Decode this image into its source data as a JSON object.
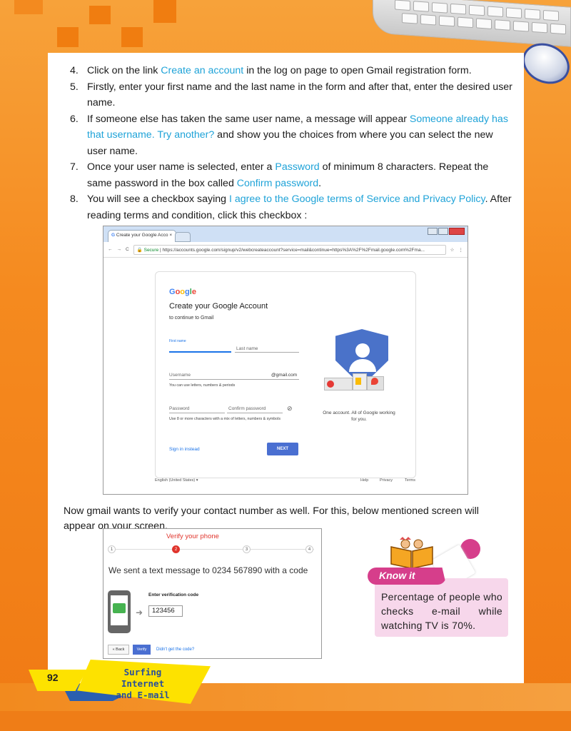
{
  "steps": [
    {
      "num": "4.",
      "parts": [
        "Click on the link ",
        "Create an account",
        " in the log on page to open Gmail registration form."
      ]
    },
    {
      "num": "5.",
      "text": "Firstly, enter your first name and the last name in the form and after that, enter the desired user name."
    },
    {
      "num": "6.",
      "parts": [
        "If someone else has taken the same user name, a message will appear ",
        "Someone already has that username. Try another?",
        " and show you the choices from where you can select the new user name."
      ]
    },
    {
      "num": "7.",
      "parts": [
        "Once your user name is selected, enter a ",
        "Password",
        " of minimum 8 characters. Repeat the same password in the box called ",
        "Confirm password",
        "."
      ]
    },
    {
      "num": "8.",
      "parts": [
        "You will see a checkbox saying ",
        "I agree to the Google terms of Service and Privacy Policy",
        ". After reading terms and condition, click this checkbox :"
      ]
    }
  ],
  "browser": {
    "tab_title": "Create your Google Acco",
    "tab_close": "×",
    "secure_label": "Secure",
    "url": "https://accounts.google.com/signup/v2/webcreateaccount?service=mail&continue=https%3A%2F%2Fmail.google.com%2Fma..."
  },
  "signup": {
    "logo": "Google",
    "title": "Create your Google Account",
    "subtitle": "to continue to Gmail",
    "first_name_label": "First name",
    "last_name_label": "Last name",
    "username_label": "Username",
    "gmail_suffix": "@gmail.com",
    "username_hint": "You can use letters, numbers & periods",
    "password_label": "Password",
    "confirm_label": "Confirm password",
    "password_hint": "Use 8 or more characters with a mix of letters, numbers & symbols",
    "signin_link": "Sign in instead",
    "next_button": "NEXT",
    "side_text": "One account. All of Google working for you.",
    "footer_lang": "English (United States) ▾",
    "footer_help": "Help",
    "footer_privacy": "Privacy",
    "footer_terms": "Terms"
  },
  "after_para": "Now gmail wants to verify your contact number as well. For this, below mentioned screen will appear on your screen.",
  "verify": {
    "title": "Verify your phone",
    "steps": [
      "1",
      "2",
      "3",
      "4"
    ],
    "sent": "We sent a text message to 0234 567890 with a code",
    "code_label": "Enter verification code",
    "code_value": "123456",
    "back": "« Back",
    "verify_button": "Verify",
    "didnt_get": "Didn't get the code?"
  },
  "know_it": {
    "title": "Know it",
    "body": "Percentage of people who checks e-mail while watching TV is 70%."
  },
  "footer": {
    "page_number": "92",
    "chapter_line1": "Surfing Internet",
    "chapter_line2": "and E-mail"
  },
  "colors": {
    "accent_orange": "#f07d10",
    "link_blue": "#1fa3d8",
    "pink": "#d63e8b",
    "yellow": "#fde200"
  }
}
